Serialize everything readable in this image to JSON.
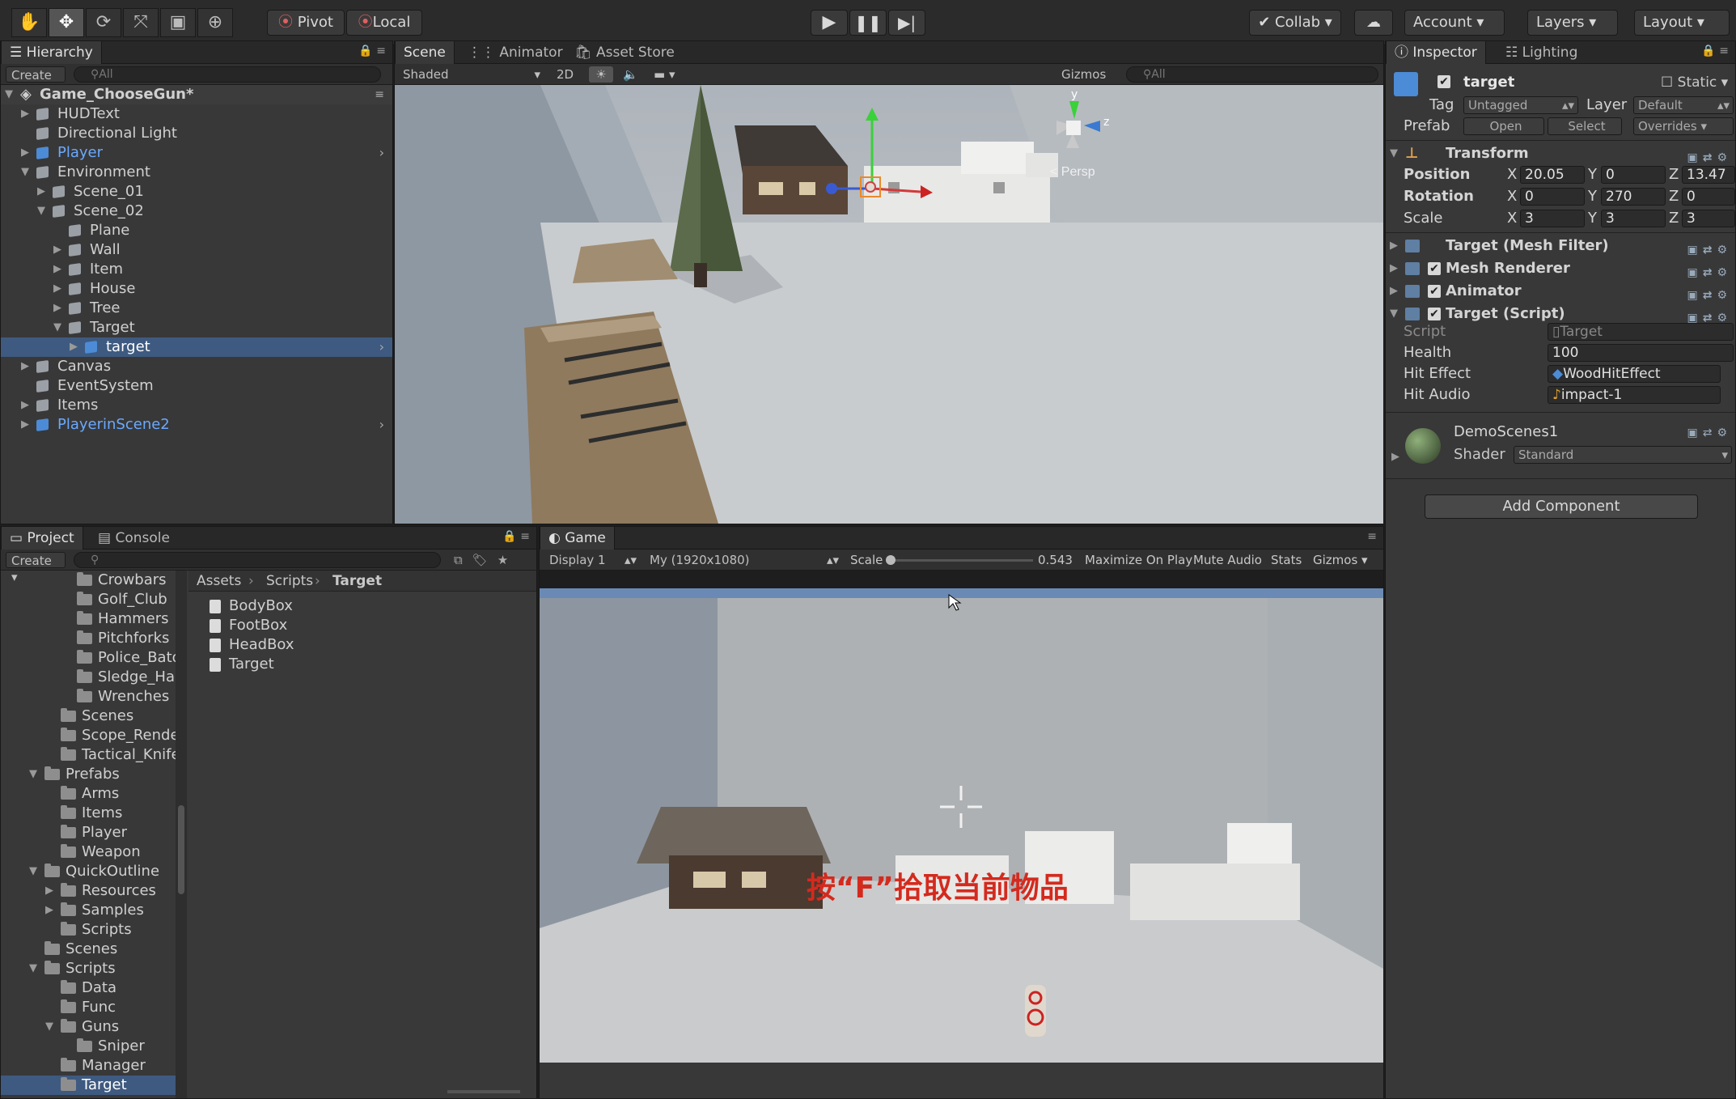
{
  "toolbar": {
    "tools": [
      "hand-tool",
      "move-tool",
      "rotate-tool",
      "scale-tool",
      "rect-tool",
      "transform-tool"
    ],
    "pivot": "Pivot",
    "local": "Local",
    "collab": "Collab",
    "account": "Account",
    "layers": "Layers",
    "layout": "Layout"
  },
  "hierarchy": {
    "tab": "Hierarchy",
    "create": "Create",
    "search_placeholder": "All",
    "scene_name": "Game_ChooseGun*",
    "items": [
      {
        "label": "HUDText",
        "depth": 1,
        "arrow": "right",
        "blue": false,
        "selected": false
      },
      {
        "label": "Directional Light",
        "depth": 1,
        "arrow": "",
        "blue": false,
        "selected": false
      },
      {
        "label": "Player",
        "depth": 1,
        "arrow": "right",
        "blue": true,
        "selected": false,
        "chev": true
      },
      {
        "label": "Environment",
        "depth": 1,
        "arrow": "down",
        "blue": false,
        "selected": false
      },
      {
        "label": "Scene_01",
        "depth": 2,
        "arrow": "right",
        "blue": false,
        "selected": false
      },
      {
        "label": "Scene_02",
        "depth": 2,
        "arrow": "down",
        "blue": false,
        "selected": false
      },
      {
        "label": "Plane",
        "depth": 3,
        "arrow": "",
        "blue": false,
        "selected": false
      },
      {
        "label": "Wall",
        "depth": 3,
        "arrow": "right",
        "blue": false,
        "selected": false
      },
      {
        "label": "Item",
        "depth": 3,
        "arrow": "right",
        "blue": false,
        "selected": false
      },
      {
        "label": "House",
        "depth": 3,
        "arrow": "right",
        "blue": false,
        "selected": false
      },
      {
        "label": "Tree",
        "depth": 3,
        "arrow": "right",
        "blue": false,
        "selected": false
      },
      {
        "label": "Target",
        "depth": 3,
        "arrow": "down",
        "blue": false,
        "selected": false
      },
      {
        "label": "target",
        "depth": 4,
        "arrow": "right",
        "blue": true,
        "selected": true,
        "chev": true
      },
      {
        "label": "Canvas",
        "depth": 1,
        "arrow": "right",
        "blue": false,
        "selected": false
      },
      {
        "label": "EventSystem",
        "depth": 1,
        "arrow": "",
        "blue": false,
        "selected": false
      },
      {
        "label": "Items",
        "depth": 1,
        "arrow": "right",
        "blue": false,
        "selected": false
      },
      {
        "label": "PlayerinScene2",
        "depth": 1,
        "arrow": "right",
        "blue": true,
        "selected": false,
        "chev": true
      }
    ]
  },
  "scene": {
    "tabs": [
      "Scene",
      "Animator",
      "Asset Store"
    ],
    "shading": "Shaded",
    "mode_2d": "2D",
    "gizmos": "Gizmos",
    "search_placeholder": "All",
    "persp": "Persp",
    "axis_labels": {
      "y": "y",
      "z": "z"
    }
  },
  "inspector": {
    "tabs": [
      "Inspector",
      "Lighting"
    ],
    "object_name": "target",
    "static": "Static",
    "tag_label": "Tag",
    "tag_value": "Untagged",
    "layer_label": "Layer",
    "layer_value": "Default",
    "prefab_label": "Prefab",
    "open": "Open",
    "select": "Select",
    "overrides": "Overrides",
    "transform": {
      "title": "Transform",
      "position": {
        "label": "Position",
        "x": "20.05",
        "y": "0",
        "z": "13.47"
      },
      "rotation": {
        "label": "Rotation",
        "x": "0",
        "y": "270",
        "z": "0"
      },
      "scale": {
        "label": "Scale",
        "x": "3",
        "y": "3",
        "z": "3"
      }
    },
    "components": [
      "Target (Mesh Filter)",
      "Mesh Renderer",
      "Animator",
      "Target (Script)"
    ],
    "script": {
      "script_label": "Script",
      "script_value": "Target",
      "health_label": "Health",
      "health_value": "100",
      "hit_effect_label": "Hit Effect",
      "hit_effect_value": "WoodHitEffect",
      "hit_audio_label": "Hit Audio",
      "hit_audio_value": "impact-1"
    },
    "material": {
      "name": "DemoScenes1",
      "shader_label": "Shader",
      "shader_value": "Standard"
    },
    "add_component": "Add Component",
    "axis": {
      "x": "X",
      "y": "Y",
      "z": "Z"
    }
  },
  "project": {
    "tabs": [
      "Project",
      "Console"
    ],
    "create": "Create",
    "folders": [
      {
        "label": "Crowbars",
        "depth": 4
      },
      {
        "label": "Golf_Club",
        "depth": 4
      },
      {
        "label": "Hammers",
        "depth": 4
      },
      {
        "label": "Pitchforks",
        "depth": 4
      },
      {
        "label": "Police_Baton",
        "depth": 4
      },
      {
        "label": "Sledge_Hammer",
        "depth": 4
      },
      {
        "label": "Wrenches",
        "depth": 4
      },
      {
        "label": "Scenes",
        "depth": 3
      },
      {
        "label": "Scope_Render",
        "depth": 3
      },
      {
        "label": "Tactical_Knife",
        "depth": 3
      },
      {
        "label": "Prefabs",
        "depth": 2,
        "arrow": "down"
      },
      {
        "label": "Arms",
        "depth": 3
      },
      {
        "label": "Items",
        "depth": 3
      },
      {
        "label": "Player",
        "depth": 3
      },
      {
        "label": "Weapon",
        "depth": 3
      },
      {
        "label": "QuickOutline",
        "depth": 2,
        "arrow": "down"
      },
      {
        "label": "Resources",
        "depth": 3,
        "arrow": "right"
      },
      {
        "label": "Samples",
        "depth": 3,
        "arrow": "right"
      },
      {
        "label": "Scripts",
        "depth": 3
      },
      {
        "label": "Scenes",
        "depth": 2
      },
      {
        "label": "Scripts",
        "depth": 2,
        "arrow": "down"
      },
      {
        "label": "Data",
        "depth": 3
      },
      {
        "label": "Func",
        "depth": 3
      },
      {
        "label": "Guns",
        "depth": 3,
        "arrow": "down"
      },
      {
        "label": "Sniper",
        "depth": 4
      },
      {
        "label": "Manager",
        "depth": 3
      },
      {
        "label": "Target",
        "depth": 3,
        "selected": true
      }
    ],
    "breadcrumb": [
      "Assets",
      "Scripts",
      "Target"
    ],
    "files": [
      "BodyBox",
      "FootBox",
      "HeadBox",
      "Target"
    ]
  },
  "game": {
    "tab": "Game",
    "display": "Display 1",
    "resolution": "My (1920x1080)",
    "scale_label": "Scale",
    "scale_value": "0.543",
    "maximize": "Maximize On Play",
    "mute": "Mute Audio",
    "stats": "Stats",
    "gizmos": "Gizmos",
    "hud_text": "按“F”拾取当前物品"
  }
}
